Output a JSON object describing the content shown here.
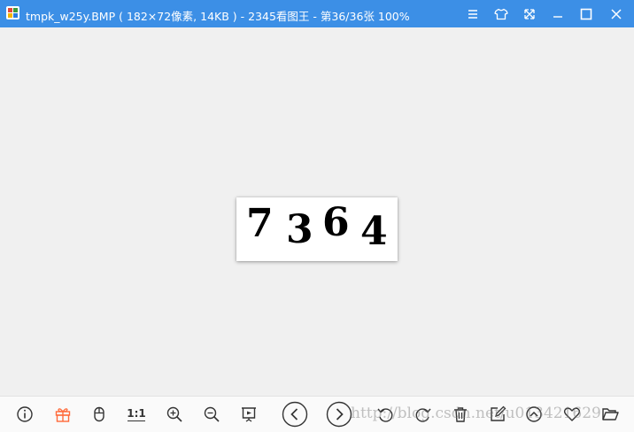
{
  "window": {
    "title": "tmpk_w25y.BMP ( 182×72像素, 14KB ) - 2345看图王 - 第36/36张 100%"
  },
  "image": {
    "digits": [
      "7",
      "3",
      "6",
      "4"
    ]
  },
  "toolbar": {
    "actual_size_label": "1:1"
  },
  "watermark": "http://blog.csdn.net/u013421629",
  "colors": {
    "titlebar": "#3c8fe6",
    "gift_icon": "#ff6a3a",
    "canvas": "#f0f0f0"
  }
}
